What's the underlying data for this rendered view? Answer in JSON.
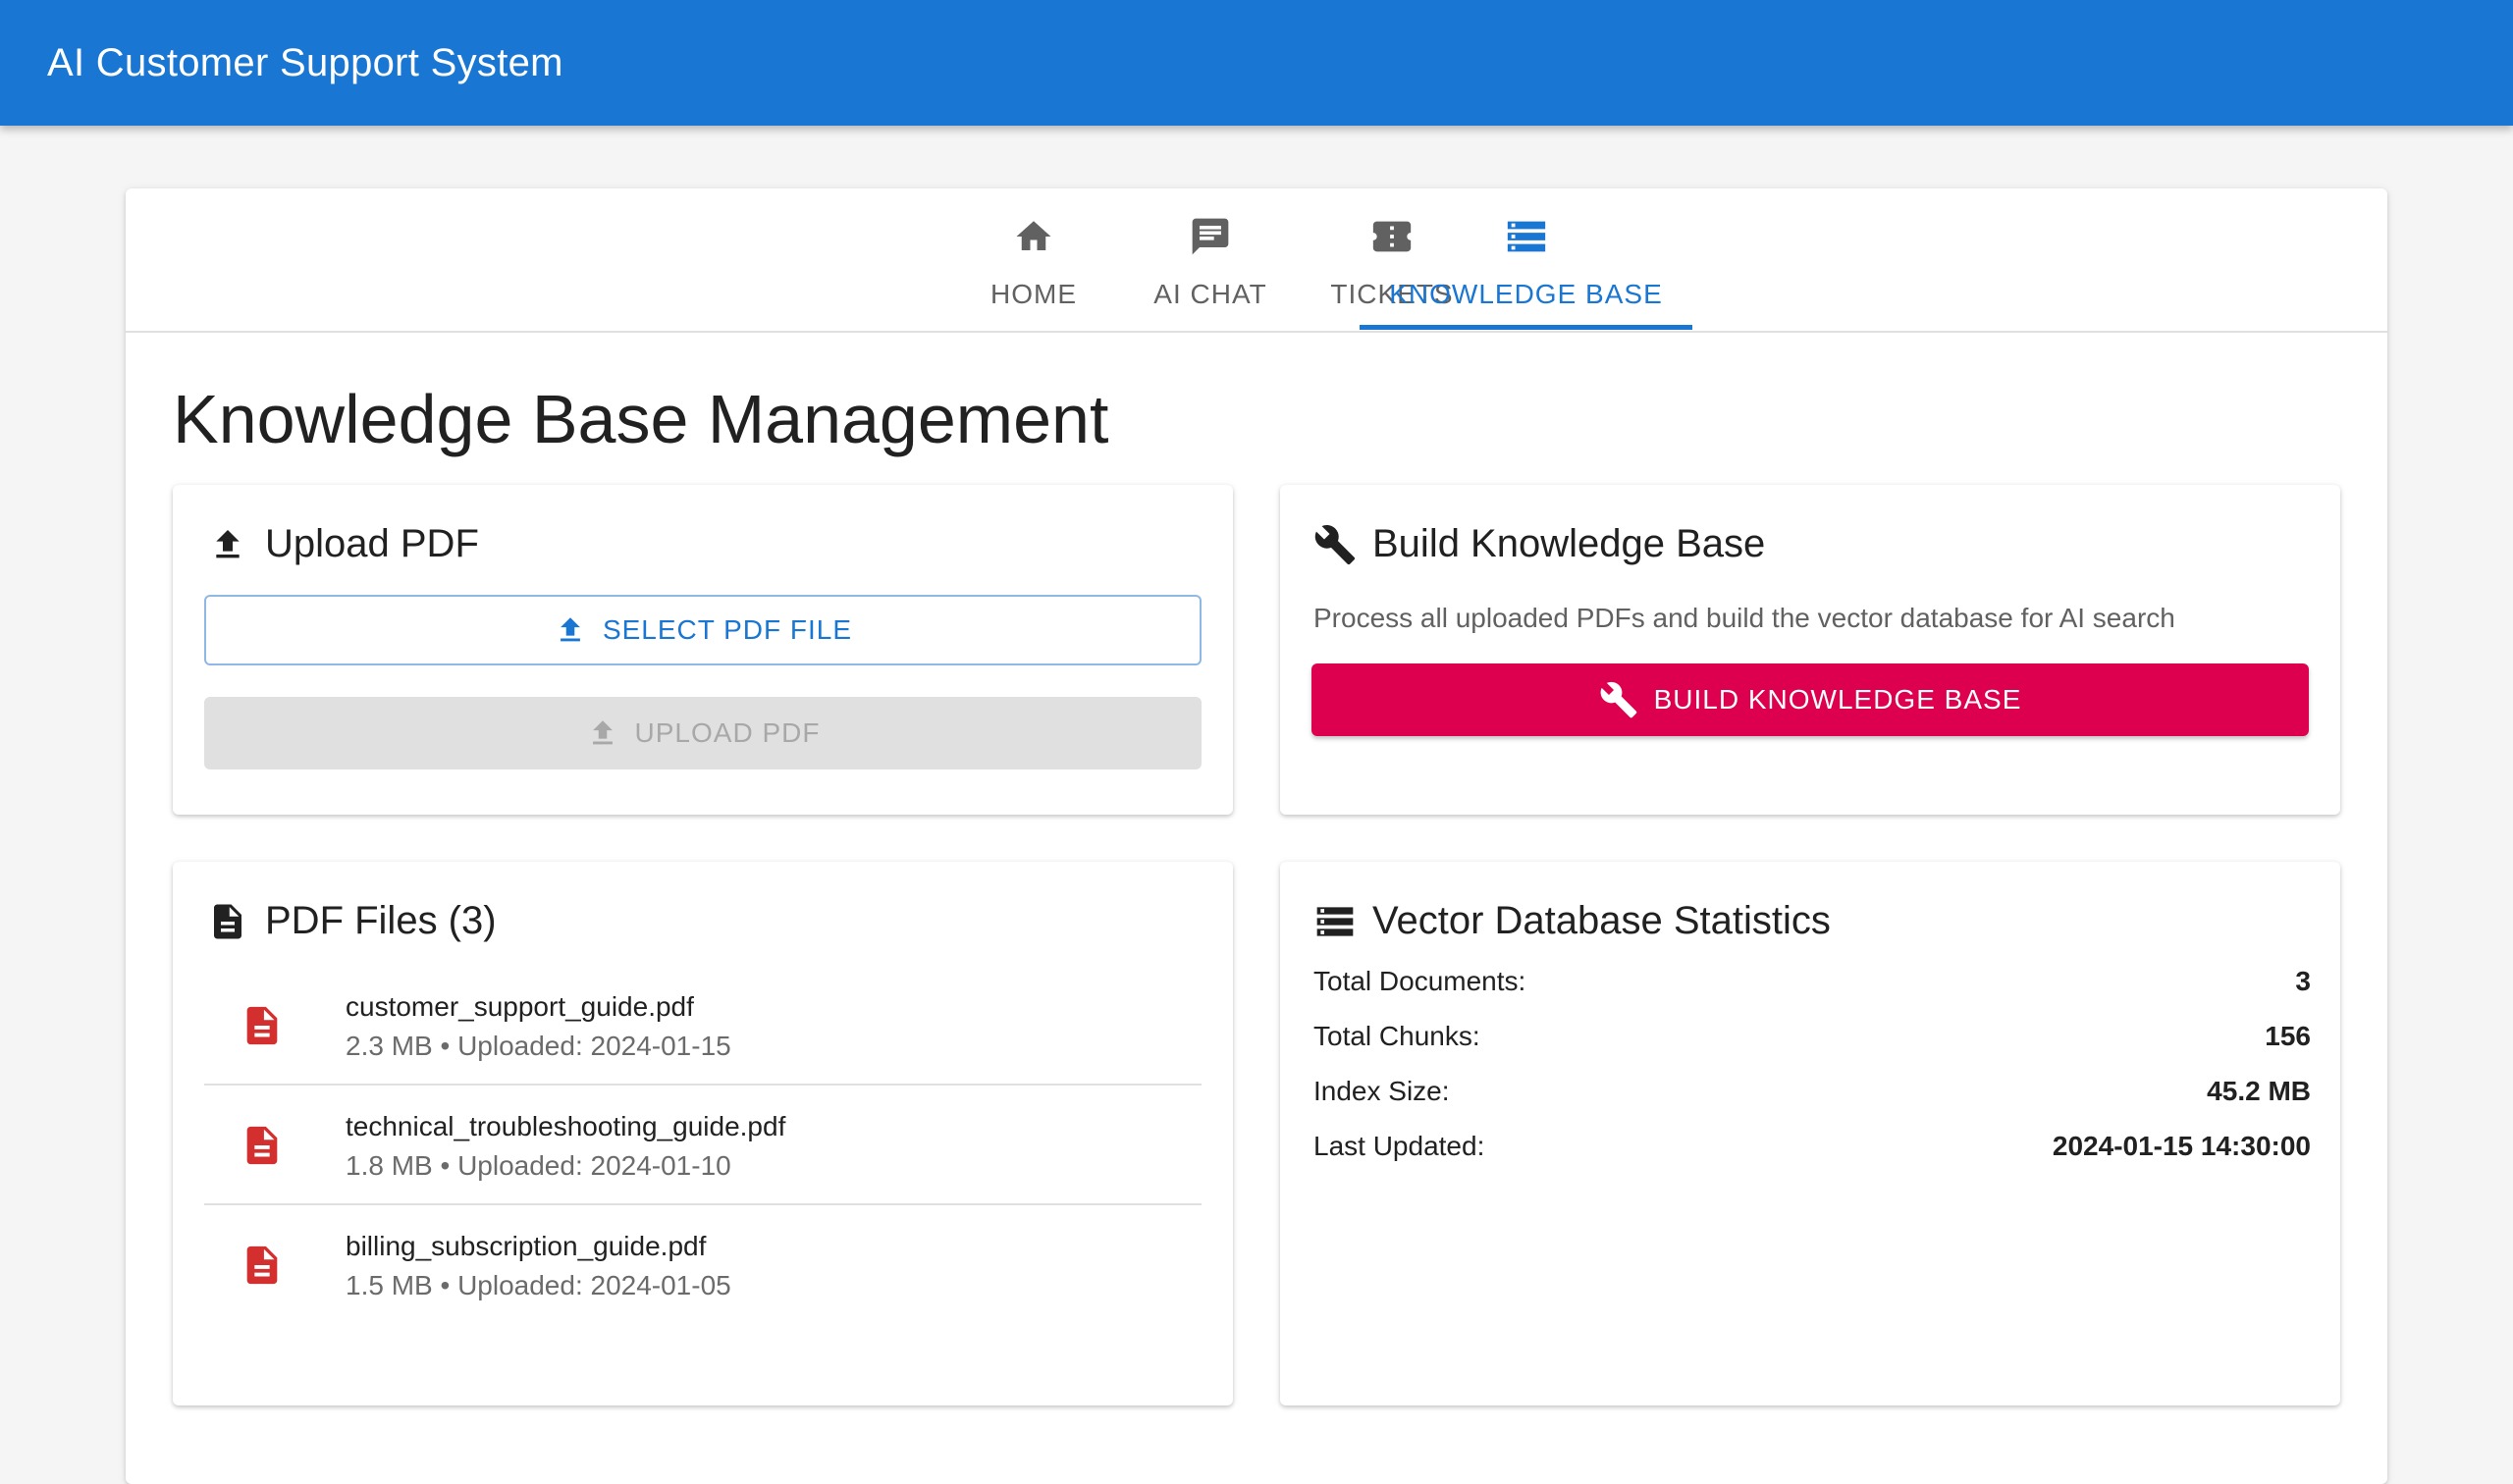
{
  "app": {
    "title": "AI Customer Support System"
  },
  "tabs": [
    {
      "label": "HOME",
      "icon": "home-icon"
    },
    {
      "label": "AI CHAT",
      "icon": "chat-icon"
    },
    {
      "label": "TICKETS",
      "icon": "ticket-icon"
    },
    {
      "label": "KNOWLEDGE BASE",
      "icon": "storage-icon",
      "active": true
    }
  ],
  "page": {
    "title": "Knowledge Base Management"
  },
  "upload": {
    "title": "Upload PDF",
    "select_label": "SELECT PDF FILE",
    "upload_label": "UPLOAD PDF"
  },
  "build": {
    "title": "Build Knowledge Base",
    "description": "Process all uploaded PDFs and build the vector database for AI search",
    "button_label": "BUILD KNOWLEDGE BASE"
  },
  "files": {
    "title": "PDF Files (3)",
    "items": [
      {
        "name": "customer_support_guide.pdf",
        "meta": "2.3 MB • Uploaded: 2024-01-15"
      },
      {
        "name": "technical_troubleshooting_guide.pdf",
        "meta": "1.8 MB • Uploaded: 2024-01-10"
      },
      {
        "name": "billing_subscription_guide.pdf",
        "meta": "1.5 MB • Uploaded: 2024-01-05"
      }
    ]
  },
  "stats": {
    "title": "Vector Database Statistics",
    "rows": [
      {
        "label": "Total Documents:",
        "value": "3"
      },
      {
        "label": "Total Chunks:",
        "value": "156"
      },
      {
        "label": "Index Size:",
        "value": "45.2 MB"
      },
      {
        "label": "Last Updated:",
        "value": "2024-01-15 14:30:00"
      }
    ]
  },
  "colors": {
    "primary": "#1976d2",
    "secondary": "#dc004e",
    "pdf_icon": "#d32f2f"
  }
}
